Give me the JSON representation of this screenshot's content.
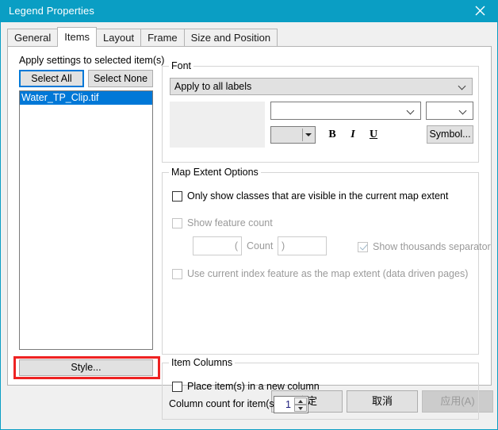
{
  "window": {
    "title": "Legend Properties",
    "close_icon": "close-icon",
    "titlebar_color": "#0a9ec4"
  },
  "tabs": [
    {
      "label": "General",
      "active": false
    },
    {
      "label": "Items",
      "active": true
    },
    {
      "label": "Layout",
      "active": false
    },
    {
      "label": "Frame",
      "active": false
    },
    {
      "label": "Size and Position",
      "active": false
    }
  ],
  "left_panel": {
    "apply_label": "Apply settings to selected item(s)",
    "select_all_label": "Select All",
    "select_none_label": "Select None",
    "items": [
      {
        "label": "Water_TP_Clip.tif",
        "selected": true
      }
    ],
    "style_label": "Style...",
    "style_highlight_color": "#ee2222"
  },
  "font_group": {
    "title": "Font",
    "apply_mode": "Apply to all labels",
    "font_name": "",
    "font_size": "",
    "color_value": "",
    "bold_label": "B",
    "italic_label": "I",
    "underline_label": "U",
    "symbol_label": "Symbol..."
  },
  "extent_group": {
    "title": "Map Extent Options",
    "only_show_label": "Only show classes that are visible in the current map extent",
    "only_show_checked": false,
    "feature_count_label": "Show feature count",
    "feature_count_checked": false,
    "feature_count_enabled": false,
    "prefix_value": "(",
    "count_label": "Count",
    "suffix_value": ")",
    "thousands_label": "Show thousands separator",
    "thousands_checked": true,
    "thousands_enabled": false,
    "index_feature_label": "Use current index feature as the map extent (data driven pages)",
    "index_feature_checked": false,
    "index_feature_enabled": false
  },
  "columns_group": {
    "title": "Item Columns",
    "new_column_label": "Place item(s) in a new column",
    "new_column_checked": false,
    "column_count_label": "Column count for item(s)",
    "column_count_value": "1"
  },
  "footer": {
    "ok_label": "确定",
    "cancel_label": "取消",
    "apply_label": "应用(A)",
    "apply_enabled": false
  }
}
